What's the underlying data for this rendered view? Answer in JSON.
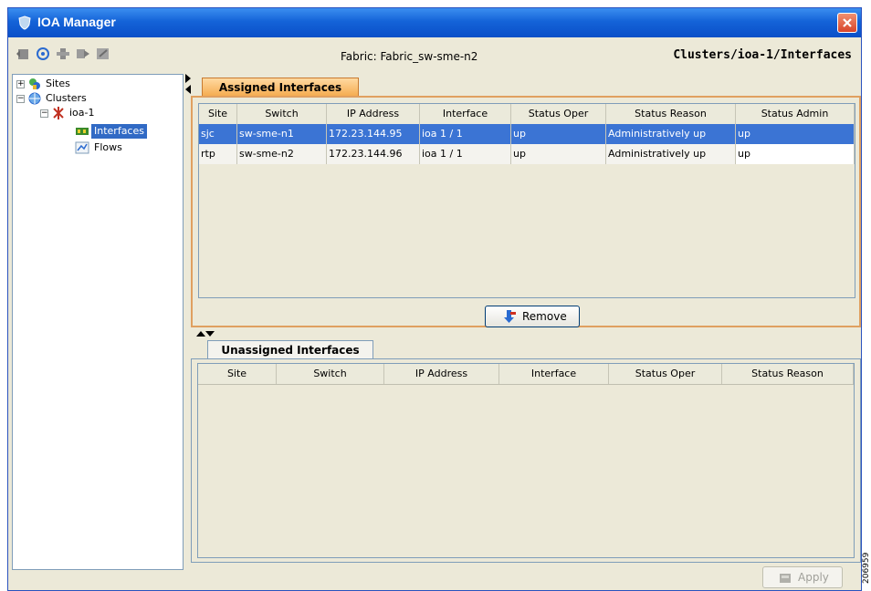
{
  "window": {
    "title": "IOA Manager"
  },
  "toolbar": {
    "fabric_label": "Fabric: Fabric_sw-sme-n2",
    "breadcrumb": "Clusters/ioa-1/Interfaces",
    "icons": [
      "back-icon",
      "discover-icon",
      "add-icon",
      "export-icon",
      "edit-icon"
    ]
  },
  "tree": {
    "sites": "Sites",
    "clusters": "Clusters",
    "cluster": "ioa-1",
    "interfaces": "Interfaces",
    "flows": "Flows"
  },
  "assigned": {
    "tab_label": "Assigned Interfaces",
    "columns": [
      "Site",
      "Switch",
      "IP Address",
      "Interface",
      "Status Oper",
      "Status Reason",
      "Status Admin"
    ],
    "rows": [
      [
        "sjc",
        "sw-sme-n1",
        "172.23.144.95",
        "ioa 1 / 1",
        "up",
        "Administratively up",
        "up"
      ],
      [
        "rtp",
        "sw-sme-n2",
        "172.23.144.96",
        "ioa 1 / 1",
        "up",
        "Administratively up",
        "up"
      ]
    ],
    "remove_label": "Remove"
  },
  "unassigned": {
    "tab_label": "Unassigned Interfaces",
    "columns": [
      "Site",
      "Switch",
      "IP Address",
      "Interface",
      "Status Oper",
      "Status Reason"
    ]
  },
  "footer": {
    "apply_label": "Apply"
  },
  "side_code": "206959",
  "colors": {
    "titlebar": "#0a4fc8",
    "selection": "#316ac5",
    "tab_active": "#f4a84a"
  }
}
